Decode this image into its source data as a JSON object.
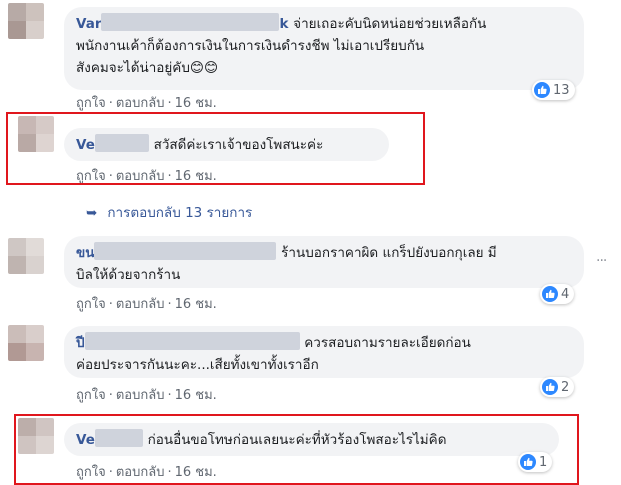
{
  "colors": {
    "link_blue": "#385898",
    "bubble_bg": "#f2f3f5",
    "meta_gray": "#606770",
    "highlight_red": "#e0161d",
    "like_blue": "#2d88ff"
  },
  "comments": [
    {
      "author_prefix": "Var",
      "author_suffix": "k",
      "line1": "จ่ายเถอะคับนิดหน่อยช่วยเหลือกัน",
      "line2": "พนักงานเค้าก็ต้องการเงินในการเงินดำรงชีพ ไม่เอาเปรียบกัน",
      "line3": "สังคมจะได้น่าอยู่คับ😊😊",
      "like_label": "ถูกใจ",
      "reply_label": "ตอบกลับ",
      "time": "16 ชม.",
      "reaction_count": "13"
    },
    {
      "author_prefix": "Ve",
      "text": "สวัสดีค่ะเราเจ้าของโพสนะค่ะ",
      "like_label": "ถูกใจ",
      "reply_label": "ตอบกลับ",
      "time": "16 ชม."
    },
    {
      "author_prefix": "ขน",
      "line1": "ร้านบอกราคาผิด แกร็ปยังบอกกุเลย มี",
      "line2": "บิลให้ด้วยจากร้าน",
      "like_label": "ถูกใจ",
      "reply_label": "ตอบกลับ",
      "time": "16 ชม.",
      "reaction_count": "4"
    },
    {
      "author_prefix": "ปี",
      "line1": "ควรสอบถามรายละเอียดก่อน",
      "line2": "ค่อยประจารกันนะคะ...เสียทั้งเขาทั้งเราอีก",
      "like_label": "ถูกใจ",
      "reply_label": "ตอบกลับ",
      "time": "16 ชม.",
      "reaction_count": "2"
    },
    {
      "author_prefix": "Ve",
      "text": "ก่อนอื่นขอโทษก่อนเลยนะค่ะที่หัวร้องโพสอะไรไม่คิด",
      "like_label": "ถูกใจ",
      "reply_label": "ตอบกลับ",
      "time": "16 ชม.",
      "reaction_count": "1"
    }
  ],
  "replies_link": "การตอบกลับ 13 รายการ"
}
